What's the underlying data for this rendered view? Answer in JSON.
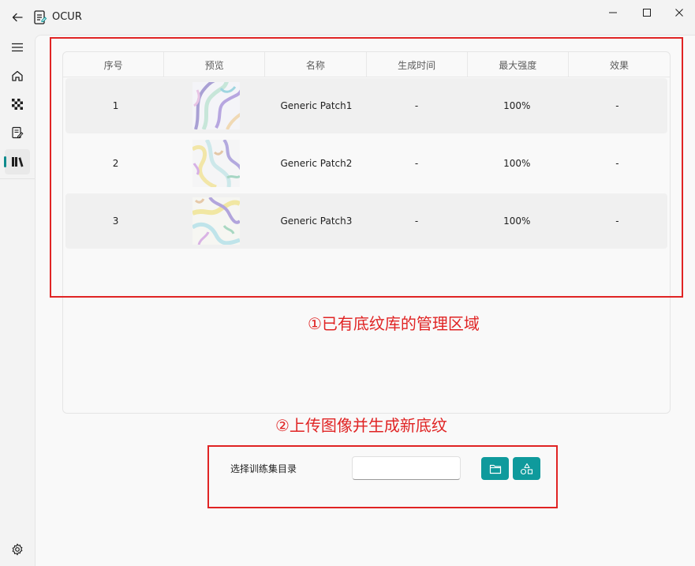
{
  "window": {
    "title": "OCUR",
    "icons": [
      "back-arrow-icon",
      "app-document-icon",
      "minimize-icon",
      "maximize-icon",
      "close-icon"
    ]
  },
  "nav": {
    "items": [
      {
        "name": "menu",
        "icon": "hamburger-icon"
      },
      {
        "name": "home",
        "icon": "home-icon"
      },
      {
        "name": "pattern",
        "icon": "checkerboard-icon"
      },
      {
        "name": "edit",
        "icon": "document-edit-icon"
      },
      {
        "name": "library",
        "icon": "library-books-icon",
        "active": true
      }
    ],
    "settings_icon": "gear-icon"
  },
  "table": {
    "columns": [
      "序号",
      "预览",
      "名称",
      "生成时间",
      "最大强度",
      "效果"
    ],
    "rows": [
      {
        "index": "1",
        "name": "Generic Patch1",
        "time": "-",
        "strength": "100%",
        "effect": "-"
      },
      {
        "index": "2",
        "name": "Generic Patch2",
        "time": "-",
        "strength": "100%",
        "effect": "-"
      },
      {
        "index": "3",
        "name": "Generic Patch3",
        "time": "-",
        "strength": "100%",
        "effect": "-"
      }
    ]
  },
  "annotations": {
    "area1": "①已有底纹库的管理区域",
    "area2": "②上传图像并生成新底纹"
  },
  "training": {
    "label": "选择训练集目录",
    "input_value": "",
    "folder_button_icon": "folder-icon",
    "generate_button_icon": "shapes-icon"
  },
  "colors": {
    "accent": "#0f9a9c",
    "annotation": "#e02424",
    "background": "#f3f3f3"
  }
}
